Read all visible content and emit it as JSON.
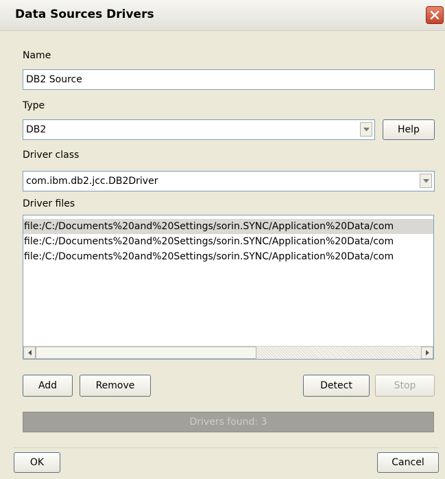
{
  "window": {
    "title": "Data Sources Drivers"
  },
  "name": {
    "label": "Name",
    "value": "DB2 Source"
  },
  "type": {
    "label": "Type",
    "value": "DB2",
    "help_label": "Help"
  },
  "driver_class": {
    "label": "Driver class",
    "value": "com.ibm.db2.jcc.DB2Driver"
  },
  "driver_files": {
    "label": "Driver files",
    "items": [
      "file:/C:/Documents%20and%20Settings/sorin.SYNC/Application%20Data/com",
      "file:/C:/Documents%20and%20Settings/sorin.SYNC/Application%20Data/com",
      "file:/C:/Documents%20and%20Settings/sorin.SYNC/Application%20Data/com"
    ]
  },
  "buttons": {
    "add": "Add",
    "remove": "Remove",
    "detect": "Detect",
    "stop": "Stop",
    "ok": "OK",
    "cancel": "Cancel"
  },
  "status": {
    "text": "Drivers found: 3"
  },
  "icons": {
    "close": "close-icon",
    "dropdown": "chevron-down-icon",
    "scroll_left": "arrow-left-icon",
    "scroll_right": "arrow-right-icon"
  },
  "colors": {
    "close_button": "#c5432b",
    "field_border": "#7f9db9"
  }
}
